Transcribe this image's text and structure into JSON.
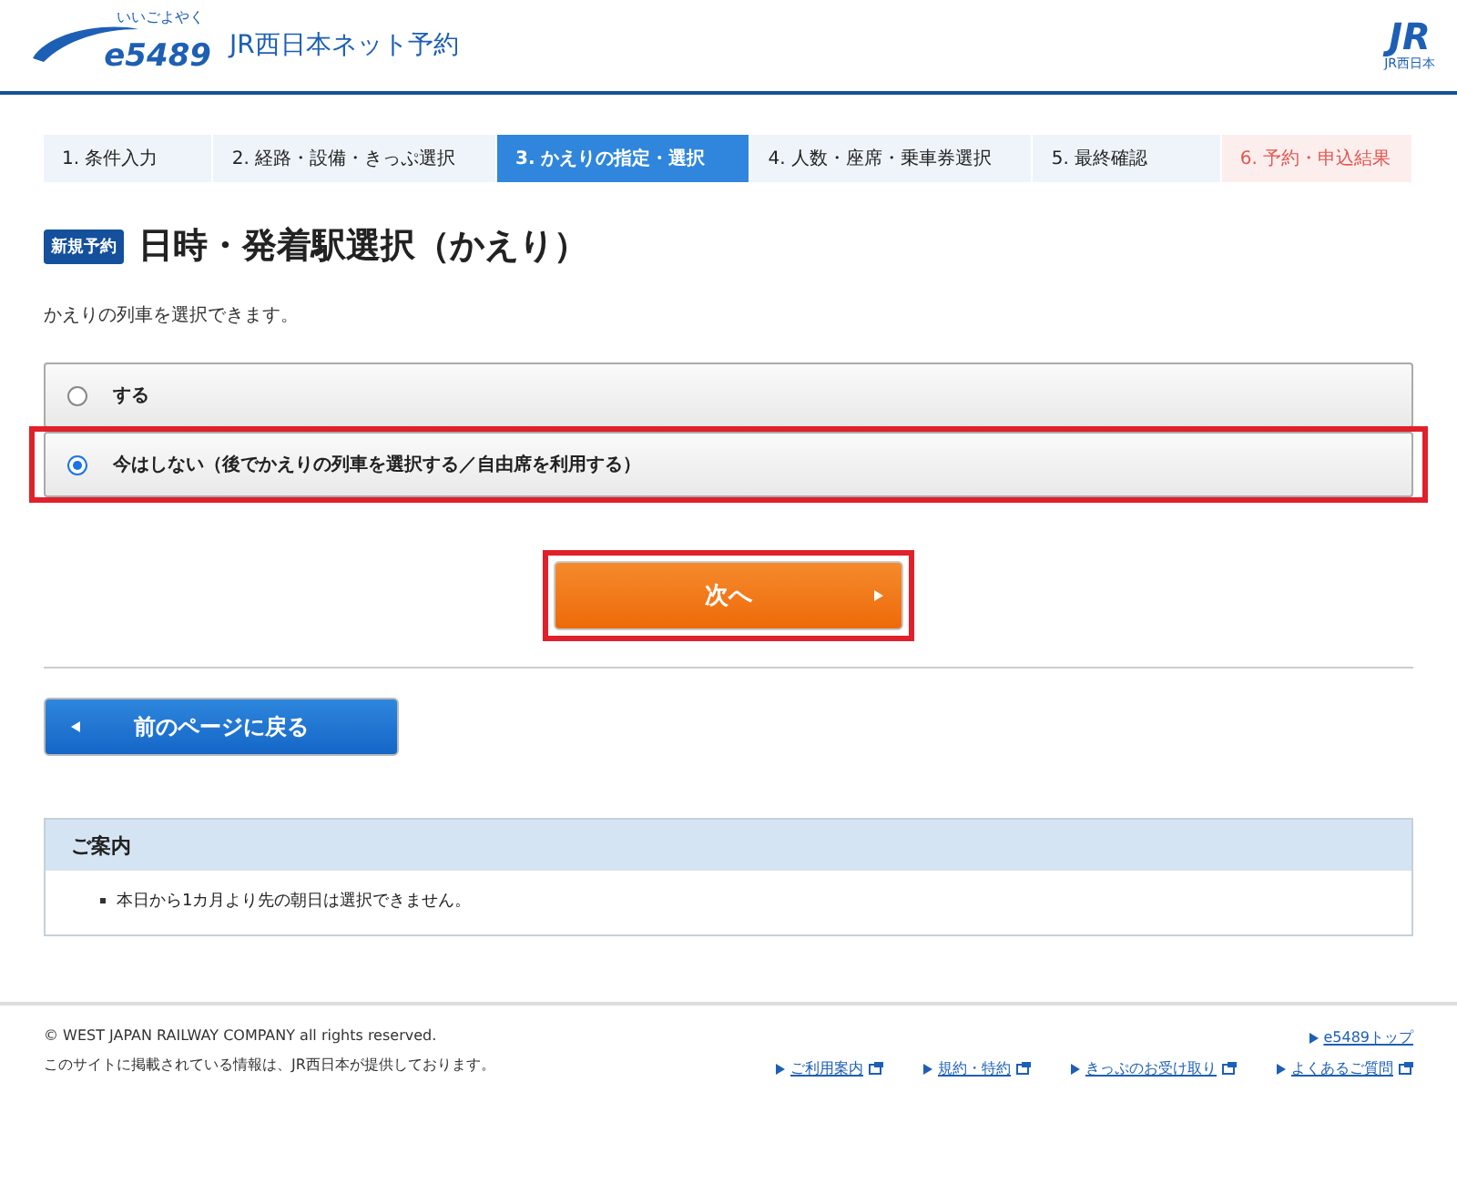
{
  "header": {
    "logo_text": "e5489",
    "logo_ruby": "いいごよやく",
    "site_title": "JR西日本ネット予約",
    "brand_mark": "JR",
    "brand_name": "JR西日本"
  },
  "steps": [
    {
      "label": "1. 条件入力",
      "selected": false,
      "kind": "step"
    },
    {
      "label": "2. 経路・設備・きっぷ選択",
      "selected": false,
      "kind": "step"
    },
    {
      "label": "3. かえりの指定・選択",
      "selected": true,
      "kind": "step"
    },
    {
      "label": "4. 人数・座席・乗車券選択",
      "selected": false,
      "kind": "step"
    },
    {
      "label": "5. 最終確認",
      "selected": false,
      "kind": "step"
    },
    {
      "label": "6. 予約・申込結果",
      "selected": false,
      "kind": "result"
    }
  ],
  "page": {
    "badge": "新規予約",
    "title": "日時・発着駅選択（かえり）",
    "description": "かえりの列車を選択できます。"
  },
  "options": [
    {
      "label": "する",
      "selected": false,
      "highlighted": false
    },
    {
      "label": "今はしない（後でかえりの列車を選択する／自由席を利用する）",
      "selected": true,
      "highlighted": true
    }
  ],
  "next_button": {
    "label": "次へ",
    "highlighted": true
  },
  "back_button": {
    "label": "前のページに戻る"
  },
  "info": {
    "title": "ご案内",
    "items": [
      "本日から1カ月より先の朝日は選択できません。"
    ]
  },
  "footer": {
    "copyright": "© WEST JAPAN RAILWAY COMPANY all rights reserved.",
    "notice": "このサイトに掲載されている情報は、JR西日本が提供しております。",
    "top_link": "e5489トップ",
    "links": [
      "ご利用案内",
      "規約・特約",
      "きっぷのお受け取り",
      "よくあるご質問"
    ]
  }
}
